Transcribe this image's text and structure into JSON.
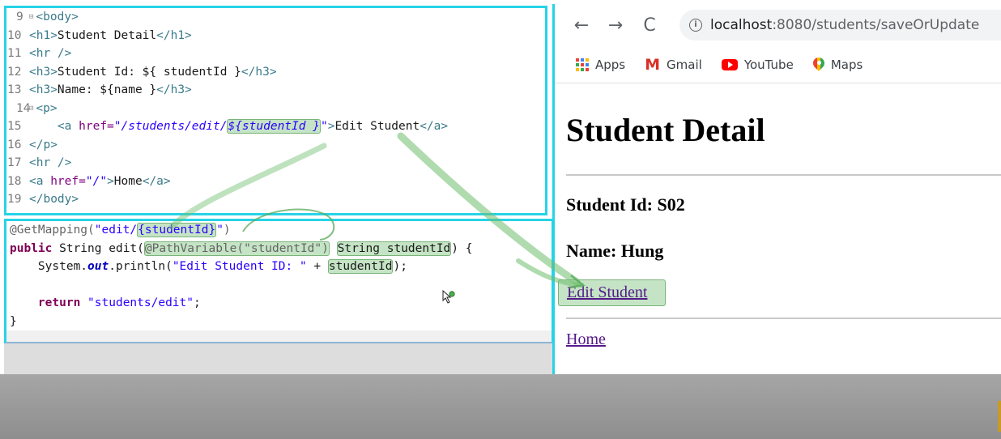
{
  "jsp_editor": {
    "lines": [
      {
        "num": "9",
        "fold": true,
        "parts": [
          {
            "t": "tag",
            "v": "<body>"
          }
        ]
      },
      {
        "num": "10",
        "parts": [
          {
            "t": "tag",
            "v": "<h1>"
          },
          {
            "t": "plain",
            "v": "Student Detail"
          },
          {
            "t": "tag",
            "v": "</h1>"
          }
        ]
      },
      {
        "num": "11",
        "parts": [
          {
            "t": "tag",
            "v": "<hr />"
          }
        ]
      },
      {
        "num": "12",
        "parts": [
          {
            "t": "tag",
            "v": "<h3>"
          },
          {
            "t": "plain",
            "v": "Student Id: ${ studentId }"
          },
          {
            "t": "tag",
            "v": "</h3>"
          }
        ]
      },
      {
        "num": "13",
        "parts": [
          {
            "t": "tag",
            "v": "<h3>"
          },
          {
            "t": "plain",
            "v": "Name: ${name }"
          },
          {
            "t": "tag",
            "v": "</h3>"
          }
        ]
      },
      {
        "num": "14",
        "fold": true,
        "parts": [
          {
            "t": "tag",
            "v": "<p>"
          }
        ]
      },
      {
        "num": "15",
        "parts": [
          {
            "t": "plain",
            "v": "    "
          },
          {
            "t": "tag",
            "v": "<a "
          },
          {
            "t": "attr",
            "v": "href="
          },
          {
            "t": "str",
            "v": "\"/students/edit/"
          },
          {
            "t": "hl",
            "v": "${studentId }"
          },
          {
            "t": "str",
            "v": "\""
          },
          {
            "t": "tag",
            "v": ">"
          },
          {
            "t": "plain",
            "v": "Edit Student"
          },
          {
            "t": "tag",
            "v": "</a>"
          }
        ]
      },
      {
        "num": "16",
        "parts": [
          {
            "t": "tag",
            "v": "</p>"
          }
        ]
      },
      {
        "num": "17",
        "parts": [
          {
            "t": "tag",
            "v": "<hr />"
          }
        ]
      },
      {
        "num": "18",
        "parts": [
          {
            "t": "tag",
            "v": "<a "
          },
          {
            "t": "attr",
            "v": "href="
          },
          {
            "t": "str",
            "v": "\"/\""
          },
          {
            "t": "tag",
            "v": ">"
          },
          {
            "t": "plain",
            "v": "Home"
          },
          {
            "t": "tag",
            "v": "</a>"
          }
        ]
      },
      {
        "num": "19",
        "parts": [
          {
            "t": "tag",
            "v": "</body>"
          }
        ]
      }
    ]
  },
  "java_editor": {
    "lines": [
      [
        {
          "t": "ann",
          "v": "@GetMapping("
        },
        {
          "t": "jstr",
          "v": "\"edit/"
        },
        {
          "t": "hlstr",
          "v": "{studentId}"
        },
        {
          "t": "jstr",
          "v": "\""
        },
        {
          "t": "ann",
          "v": ")"
        }
      ],
      [
        {
          "t": "kw",
          "v": "public"
        },
        {
          "t": "plain",
          "v": " String edit("
        },
        {
          "t": "hlann",
          "v": "@PathVariable(\"studentId\")"
        },
        {
          "t": "plain",
          "v": " "
        },
        {
          "t": "hl",
          "v": "String studentId"
        },
        {
          "t": "plain",
          "v": ") {"
        }
      ],
      [
        {
          "t": "plain",
          "v": "    System."
        },
        {
          "t": "field",
          "v": "out"
        },
        {
          "t": "plain",
          "v": ".println("
        },
        {
          "t": "jstr",
          "v": "\"Edit Student ID: \""
        },
        {
          "t": "plain",
          "v": " + "
        },
        {
          "t": "hl",
          "v": "studentId"
        },
        {
          "t": "plain",
          "v": ");"
        }
      ],
      [
        {
          "t": "plain",
          "v": ""
        }
      ],
      [
        {
          "t": "plain",
          "v": "    "
        },
        {
          "t": "kw",
          "v": "return"
        },
        {
          "t": "plain",
          "v": " "
        },
        {
          "t": "jstr",
          "v": "\"students/edit\""
        },
        {
          "t": "plain",
          "v": ";"
        }
      ],
      [
        {
          "t": "plain",
          "v": "}"
        }
      ]
    ]
  },
  "browser": {
    "nav": {
      "back": "←",
      "forward": "→",
      "reload": "C"
    },
    "address": {
      "host": "localhost",
      "path": ":8080/students/saveOrUpdate"
    },
    "bookmarks": [
      "Apps",
      "Gmail",
      "YouTube",
      "Maps"
    ],
    "gmail_glyph": "M",
    "page": {
      "h1": "Student Detail",
      "student_id": "Student Id: S02",
      "name": "Name: Hung",
      "edit_link": "Edit Student",
      "home_link": "Home"
    }
  },
  "colors": {
    "editor_border": "#27d3e8",
    "highlight": "#7ec47e",
    "link_visited": "#551a8b"
  },
  "icons": [
    "back-arrow-icon",
    "forward-arrow-icon",
    "reload-icon",
    "info-icon",
    "apps-grid-icon",
    "gmail-icon",
    "youtube-icon",
    "maps-icon",
    "mouse-cursor-icon"
  ]
}
